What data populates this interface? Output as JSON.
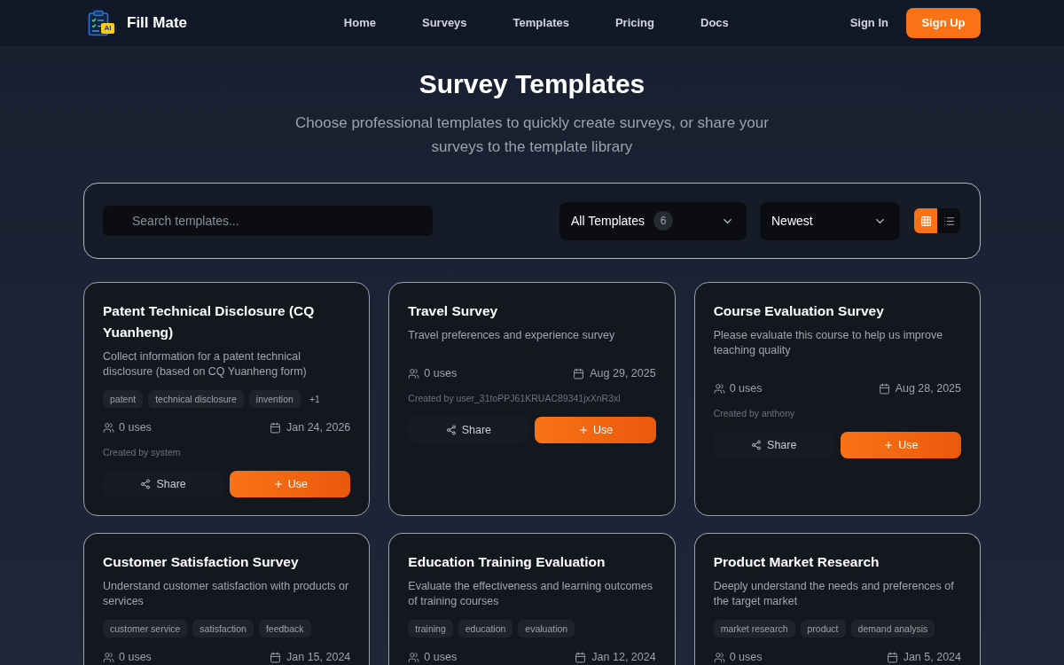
{
  "header": {
    "logo": {
      "badge": "AI",
      "name": "Fill Mate"
    },
    "nav": [
      "Home",
      "Surveys",
      "Templates",
      "Pricing",
      "Docs"
    ],
    "sign_in": "Sign In",
    "sign_up": "Sign Up"
  },
  "hero": {
    "title": "Survey Templates",
    "subtitle": "Choose professional templates to quickly create surveys, or share your surveys to the template library"
  },
  "filters": {
    "search": {
      "placeholder": "Search templates..."
    },
    "category": {
      "value": "All Templates",
      "count": "6"
    },
    "sort": {
      "value": "Newest"
    },
    "view_toggle": [
      {
        "kind": "grid",
        "selected": true
      },
      {
        "kind": "list",
        "selected": false
      }
    ]
  },
  "templates": [
    {
      "title": "Patent Technical Disclosure (CQ Yuanheng)",
      "description": "Collect information for a patent technical disclosure (based on CQ Yuanheng form)",
      "tags": [
        "patent",
        "technical disclosure",
        "invention"
      ],
      "more_tags": "+1",
      "uses": "0 uses",
      "date": "Jan 24, 2026",
      "created_by": "Created by system",
      "actions": {
        "share": "Share",
        "use": "Use"
      }
    },
    {
      "title": "Travel Survey",
      "description": "Travel preferences and experience survey",
      "uses": "0 uses",
      "date": "Aug 29, 2025",
      "created_by": "Created by user_31toPPJ61KRUAC89341jxXnR3xl",
      "actions": {
        "share": "Share",
        "use": "Use"
      }
    },
    {
      "title": "Course Evaluation Survey",
      "description": "Please evaluate this course to help us improve teaching quality",
      "uses": "0 uses",
      "date": "Aug 28, 2025",
      "created_by": "Created by anthony",
      "actions": {
        "share": "Share",
        "use": "Use"
      }
    },
    {
      "title": "Customer Satisfaction Survey",
      "description": "Understand customer satisfaction with products or services",
      "tags": [
        "customer service",
        "satisfaction",
        "feedback"
      ],
      "uses": "0 uses",
      "date": "Jan 15, 2024"
    },
    {
      "title": "Education Training Evaluation",
      "description": "Evaluate the effectiveness and learning outcomes of training courses",
      "tags": [
        "training",
        "education",
        "evaluation"
      ],
      "uses": "0 uses",
      "date": "Jan 12, 2024"
    },
    {
      "title": "Product Market Research",
      "description": "Deeply understand the needs and preferences of the target market",
      "tags": [
        "market research",
        "product",
        "demand analysis"
      ],
      "uses": "0 uses",
      "date": "Jan 5, 2024"
    }
  ]
}
